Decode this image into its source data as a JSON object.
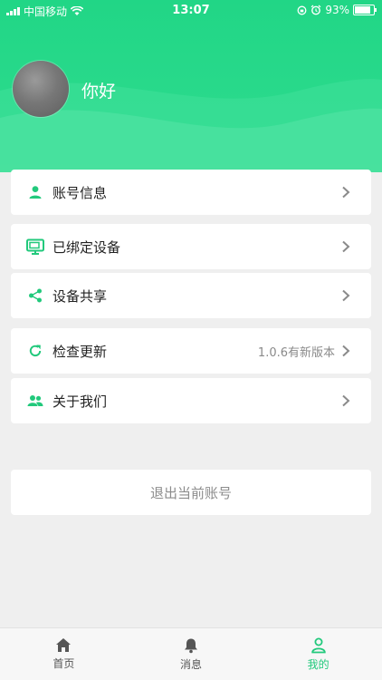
{
  "status_bar": {
    "carrier": "中国移动",
    "time": "13:07",
    "battery": "93%",
    "battery_level": 0.93
  },
  "profile": {
    "greeting": "你好"
  },
  "menu": {
    "account_info": "账号信息",
    "bound_devices": "已绑定设备",
    "device_share": "设备共享",
    "check_update": "检查更新",
    "update_status": "1.0.6有新版本",
    "about_us": "关于我们"
  },
  "logout_label": "退出当前账号",
  "tabs": {
    "home": "首页",
    "messages": "消息",
    "mine": "我的"
  },
  "colors": {
    "brand_green": "#22c97c",
    "header_green": "#21d686"
  },
  "icons": {
    "account_info": "person-icon",
    "bound_devices": "monitor-icon",
    "device_share": "share-icon",
    "check_update": "refresh-icon",
    "about_us": "group-icon",
    "home": "home-icon",
    "messages": "bell-icon",
    "mine": "user-outline-icon"
  }
}
